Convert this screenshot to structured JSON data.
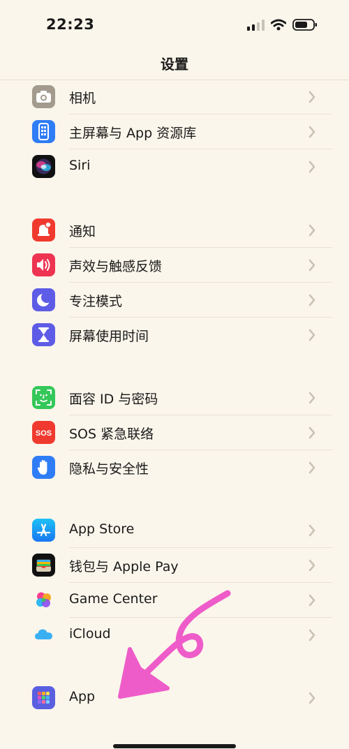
{
  "status_bar": {
    "time": "22:23"
  },
  "nav": {
    "title": "设置"
  },
  "colors": {
    "annotation_arrow": "#ee5cc9",
    "chevron": "#c9c2b4"
  },
  "groups": [
    {
      "items": [
        {
          "label": "相机",
          "icon": "camera-icon"
        },
        {
          "label": "主屏幕与 App 资源库",
          "icon": "home-screen-icon"
        },
        {
          "label": "Siri",
          "icon": "siri-icon"
        }
      ]
    },
    {
      "items": [
        {
          "label": "通知",
          "icon": "notifications-icon"
        },
        {
          "label": "声效与触感反馈",
          "icon": "sounds-icon"
        },
        {
          "label": "专注模式",
          "icon": "focus-moon-icon"
        },
        {
          "label": "屏幕使用时间",
          "icon": "hourglass-icon"
        }
      ]
    },
    {
      "items": [
        {
          "label": "面容 ID 与密码",
          "icon": "face-id-icon"
        },
        {
          "label": "SOS 紧急联络",
          "icon": "sos-icon",
          "icon_text": "SOS"
        },
        {
          "label": "隐私与安全性",
          "icon": "privacy-hand-icon"
        }
      ]
    },
    {
      "items": [
        {
          "label": "App Store",
          "icon": "app-store-icon"
        },
        {
          "label": "钱包与 Apple Pay",
          "icon": "wallet-icon"
        },
        {
          "label": "Game Center",
          "icon": "game-center-icon"
        },
        {
          "label": "iCloud",
          "icon": "icloud-icon"
        }
      ]
    },
    {
      "items": [
        {
          "label": "App",
          "icon": "apps-grid-icon"
        }
      ]
    }
  ]
}
